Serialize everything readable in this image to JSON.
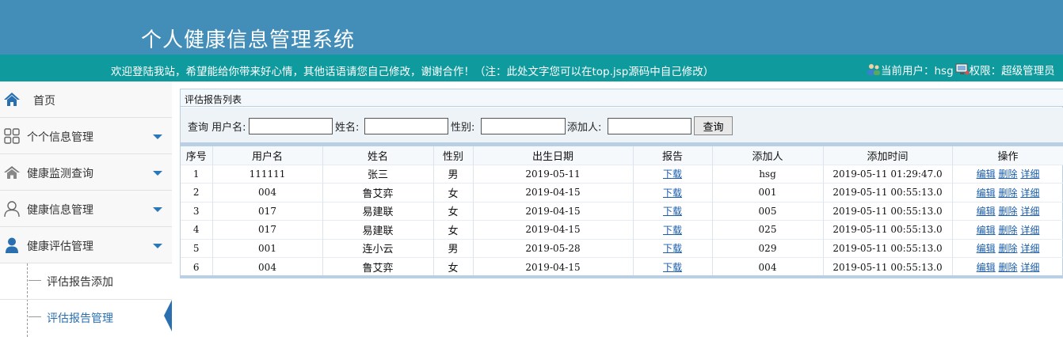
{
  "header": {
    "title": "个人健康信息管理系统"
  },
  "notice_bar": {
    "notice": "欢迎登陆我站，希望能给你带来好心情，其他话语请您自己修改，谢谢合作！（注：此处文字您可以在top.jsp源码中自己修改）",
    "current_user": "当前用户：hsg",
    "role": "权限：超级管理员"
  },
  "sidebar": {
    "home": "首页",
    "items": [
      {
        "label": "个个信息管理",
        "icon": "grid-icon"
      },
      {
        "label": "健康监测查询",
        "icon": "house-icon"
      },
      {
        "label": "健康信息管理",
        "icon": "user-outline-icon"
      },
      {
        "label": "健康评估管理",
        "icon": "user-solid-icon"
      }
    ],
    "sub_items": [
      {
        "label": "评估报告添加"
      },
      {
        "label": "评估报告管理"
      }
    ]
  },
  "panel": {
    "title": "评估报告列表",
    "search": {
      "prefix": "查询 用户名:",
      "name_label": "姓名:",
      "gender_label": "性别:",
      "adder_label": "添加人:",
      "username_value": "",
      "name_value": "",
      "gender_value": "",
      "adder_value": "",
      "button": "查询"
    },
    "columns": [
      "序号",
      "用户名",
      "姓名",
      "性别",
      "出生日期",
      "报告",
      "添加人",
      "添加时间",
      "操作"
    ],
    "rows": [
      {
        "no": "1",
        "username": "111111",
        "name": "张三",
        "gender": "男",
        "birth": "2019-05-11",
        "report": "下载",
        "adder": "hsg",
        "added": "2019-05-11 01:29:47.0"
      },
      {
        "no": "2",
        "username": "004",
        "name": "鲁艾弈",
        "gender": "女",
        "birth": "2019-04-15",
        "report": "下载",
        "adder": "001",
        "added": "2019-05-11 00:55:13.0"
      },
      {
        "no": "3",
        "username": "017",
        "name": "易建联",
        "gender": "女",
        "birth": "2019-04-15",
        "report": "下载",
        "adder": "005",
        "added": "2019-05-11 00:55:13.0"
      },
      {
        "no": "4",
        "username": "017",
        "name": "易建联",
        "gender": "女",
        "birth": "2019-04-15",
        "report": "下载",
        "adder": "025",
        "added": "2019-05-11 00:55:13.0"
      },
      {
        "no": "5",
        "username": "001",
        "name": "连小云",
        "gender": "男",
        "birth": "2019-05-28",
        "report": "下载",
        "adder": "029",
        "added": "2019-05-11 00:55:13.0"
      },
      {
        "no": "6",
        "username": "004",
        "name": "鲁艾弈",
        "gender": "女",
        "birth": "2019-04-15",
        "report": "下载",
        "adder": "004",
        "added": "2019-05-11 00:55:13.0"
      }
    ],
    "actions": {
      "edit": "编辑",
      "delete": "删除",
      "detail": "详细"
    }
  },
  "colors": {
    "header_bg": "#438eb9",
    "notice_bg": "#0f9a9e",
    "accent": "#2a6fb0",
    "link": "#1a5ca8"
  }
}
